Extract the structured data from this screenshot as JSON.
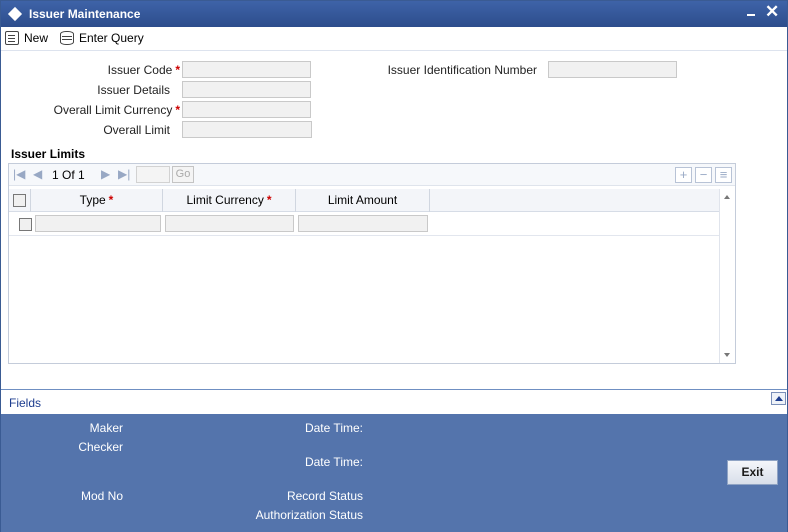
{
  "window": {
    "title": "Issuer Maintenance"
  },
  "toolbar": {
    "new_label": "New",
    "enter_query_label": "Enter Query"
  },
  "form": {
    "issuer_code_label": "Issuer Code",
    "issuer_code_value": "",
    "issuer_details_label": "Issuer Details",
    "issuer_details_value": "",
    "overall_limit_currency_label": "Overall Limit Currency",
    "overall_limit_currency_value": "",
    "overall_limit_label": "Overall Limit",
    "overall_limit_value": "",
    "issuer_id_number_label": "Issuer Identification Number",
    "issuer_id_number_value": "",
    "required_marker": "*"
  },
  "issuer_limits": {
    "title": "Issuer Limits",
    "pager": {
      "text": "1 Of 1",
      "go_label": "Go",
      "page_input": ""
    },
    "columns": [
      "Type",
      "Limit Currency",
      "Limit Amount"
    ],
    "rows": [
      {
        "type": "",
        "limit_currency": "",
        "limit_amount": ""
      }
    ]
  },
  "fields_link": "Fields",
  "footer": {
    "maker_label": "Maker",
    "checker_label": "Checker",
    "date_time_label": "Date Time:",
    "mod_no_label": "Mod No",
    "record_status_label": "Record Status",
    "authorization_status_label": "Authorization Status",
    "exit_label": "Exit"
  }
}
